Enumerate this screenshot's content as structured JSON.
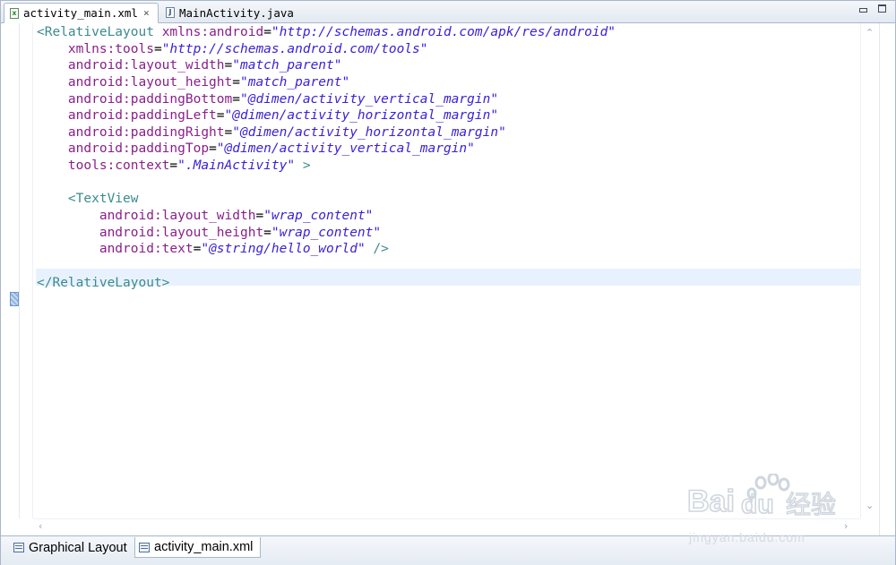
{
  "tabs": [
    {
      "label": "activity_main.xml",
      "icon": "xml-file-icon",
      "active": true,
      "close": "⨯"
    },
    {
      "label": "MainActivity.java",
      "icon": "java-file-icon",
      "active": false
    }
  ],
  "code_lines": [
    [
      [
        "tag",
        "<RelativeLayout "
      ],
      [
        "attr",
        "xmlns:android"
      ],
      [
        "punct",
        "="
      ],
      [
        "val",
        "\"http://schemas.android.com/apk/res/android\""
      ]
    ],
    [
      [
        "punct",
        "    "
      ],
      [
        "attr",
        "xmlns:tools"
      ],
      [
        "punct",
        "="
      ],
      [
        "val",
        "\"http://schemas.android.com/tools\""
      ]
    ],
    [
      [
        "punct",
        "    "
      ],
      [
        "attr",
        "android:layout_width"
      ],
      [
        "punct",
        "="
      ],
      [
        "val",
        "\"match_parent\""
      ]
    ],
    [
      [
        "punct",
        "    "
      ],
      [
        "attr",
        "android:layout_height"
      ],
      [
        "punct",
        "="
      ],
      [
        "val",
        "\"match_parent\""
      ]
    ],
    [
      [
        "punct",
        "    "
      ],
      [
        "attr",
        "android:paddingBottom"
      ],
      [
        "punct",
        "="
      ],
      [
        "val",
        "\"@dimen/activity_vertical_margin\""
      ]
    ],
    [
      [
        "punct",
        "    "
      ],
      [
        "attr",
        "android:paddingLeft"
      ],
      [
        "punct",
        "="
      ],
      [
        "val",
        "\"@dimen/activity_horizontal_margin\""
      ]
    ],
    [
      [
        "punct",
        "    "
      ],
      [
        "attr",
        "android:paddingRight"
      ],
      [
        "punct",
        "="
      ],
      [
        "val",
        "\"@dimen/activity_horizontal_margin\""
      ]
    ],
    [
      [
        "punct",
        "    "
      ],
      [
        "attr",
        "android:paddingTop"
      ],
      [
        "punct",
        "="
      ],
      [
        "val",
        "\"@dimen/activity_vertical_margin\""
      ]
    ],
    [
      [
        "punct",
        "    "
      ],
      [
        "attr",
        "tools:context"
      ],
      [
        "punct",
        "="
      ],
      [
        "val",
        "\".MainActivity\""
      ],
      [
        "tag",
        " >"
      ]
    ],
    [],
    [
      [
        "punct",
        "    "
      ],
      [
        "tag",
        "<TextView"
      ]
    ],
    [
      [
        "punct",
        "        "
      ],
      [
        "attr",
        "android:layout_width"
      ],
      [
        "punct",
        "="
      ],
      [
        "val",
        "\"wrap_content\""
      ]
    ],
    [
      [
        "punct",
        "        "
      ],
      [
        "attr",
        "android:layout_height"
      ],
      [
        "punct",
        "="
      ],
      [
        "val",
        "\"wrap_content\""
      ]
    ],
    [
      [
        "punct",
        "        "
      ],
      [
        "attr",
        "android:text"
      ],
      [
        "punct",
        "="
      ],
      [
        "val",
        "\"@string/hello_world\""
      ],
      [
        "tag",
        " />"
      ]
    ],
    [],
    [
      [
        "tag",
        "</RelativeLayout>"
      ]
    ],
    []
  ],
  "bottom_tabs": [
    {
      "label": "Graphical Layout",
      "icon": "layout-icon",
      "active": false
    },
    {
      "label": "activity_main.xml",
      "icon": "xml-source-icon",
      "active": true
    }
  ],
  "watermark": {
    "brand": "Bai",
    "brand2": "du",
    "cn": "经验",
    "url": "jingyan.baidu.com"
  },
  "colors": {
    "tag": "#3b8b8e",
    "attr": "#8a1f8a",
    "value": "#3a21d8",
    "current_line": "#e8f2fe"
  }
}
